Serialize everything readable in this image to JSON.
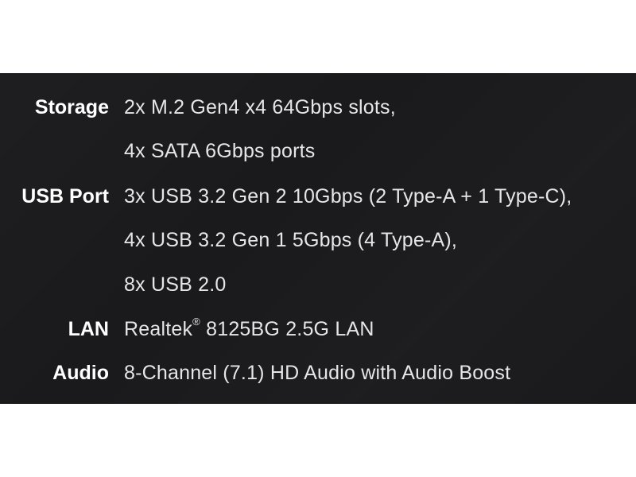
{
  "specs": [
    {
      "label": "Storage",
      "lines": [
        "2x M.2 Gen4 x4 64Gbps slots,",
        "4x SATA 6Gbps ports"
      ]
    },
    {
      "label": "USB Port",
      "lines": [
        "3x USB 3.2 Gen 2 10Gbps (2 Type-A + 1 Type-C),",
        "4x USB 3.2 Gen 1 5Gbps (4 Type-A),",
        "8x USB 2.0"
      ]
    },
    {
      "label": "LAN",
      "lines": [
        "Realtek",
        "8125BG 2.5G LAN"
      ],
      "registered_mark": "®"
    },
    {
      "label": "Audio",
      "lines": [
        "8-Channel (7.1) HD Audio with Audio Boost"
      ]
    }
  ]
}
